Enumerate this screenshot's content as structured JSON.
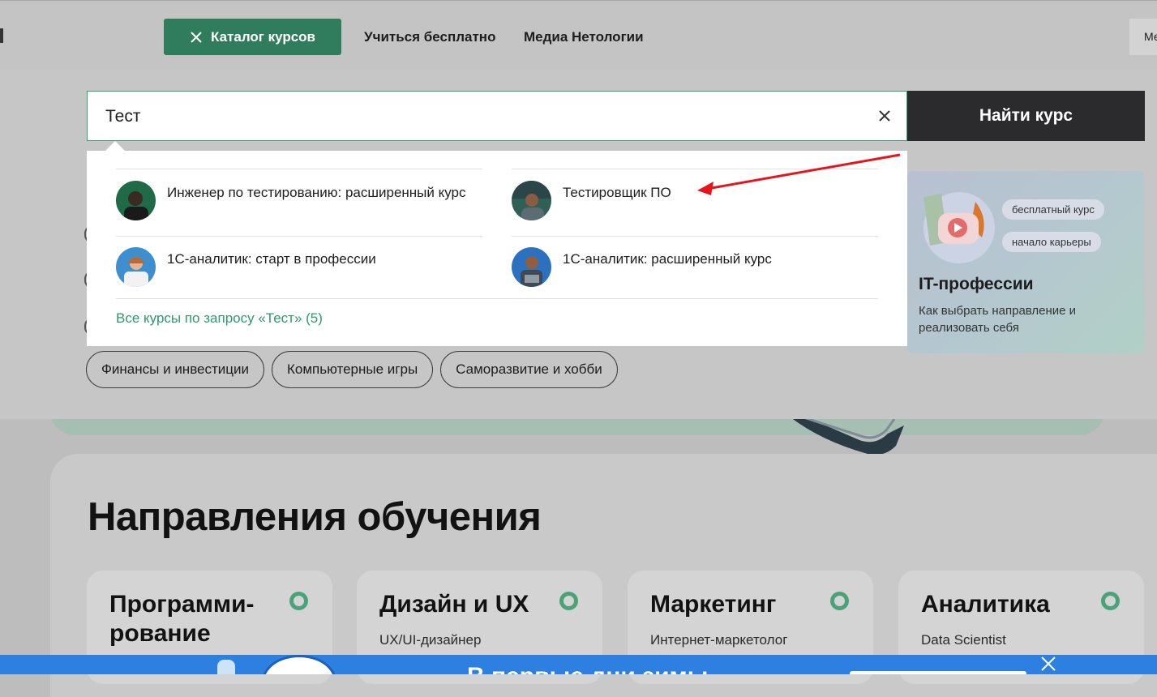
{
  "header": {
    "catalog_button": "Каталог курсов",
    "nav": [
      "Учиться бесплатно",
      "Медиа Нетологии"
    ],
    "right_fragment": "Ме"
  },
  "search": {
    "value": "Тест",
    "submit_label": "Найти курс"
  },
  "suggestions": {
    "results": [
      {
        "title": "Инженер по тестированию: расширенный курс"
      },
      {
        "title": "Тестировщик ПО"
      },
      {
        "title": "1С-аналитик: старт в профессии"
      },
      {
        "title": "1С-аналитик: расширенный курс"
      }
    ],
    "all_link": "Все курсы по запросу «Тест» (5)"
  },
  "tags": [
    "Финансы и инвестиции",
    "Компьютерные игры",
    "Саморазвитие и хобби"
  ],
  "promo": {
    "badges": [
      "бесплатный курс",
      "начало карьеры"
    ],
    "title": "IT-профессии",
    "subtitle": "Как выбрать направление и реализовать себя"
  },
  "directions": {
    "title": "Направления обучения",
    "cards": [
      {
        "title": "Программи-\nрование",
        "sub": ""
      },
      {
        "title": "Дизайн и UX",
        "sub": "UX/UI-дизайнер"
      },
      {
        "title": "Маркетинг",
        "sub": "Интернет-маркетолог"
      },
      {
        "title": "Аналитика",
        "sub": "Data Scientist"
      }
    ]
  },
  "banner": {
    "text": "В первые дни зимы"
  },
  "colors": {
    "accent_green": "#2f7d5c",
    "link_green": "#2d9a6a",
    "dark_button": "#2b2b2e",
    "annotation_arrow": "#e8141c",
    "banner_blue": "#2d7fe0"
  }
}
